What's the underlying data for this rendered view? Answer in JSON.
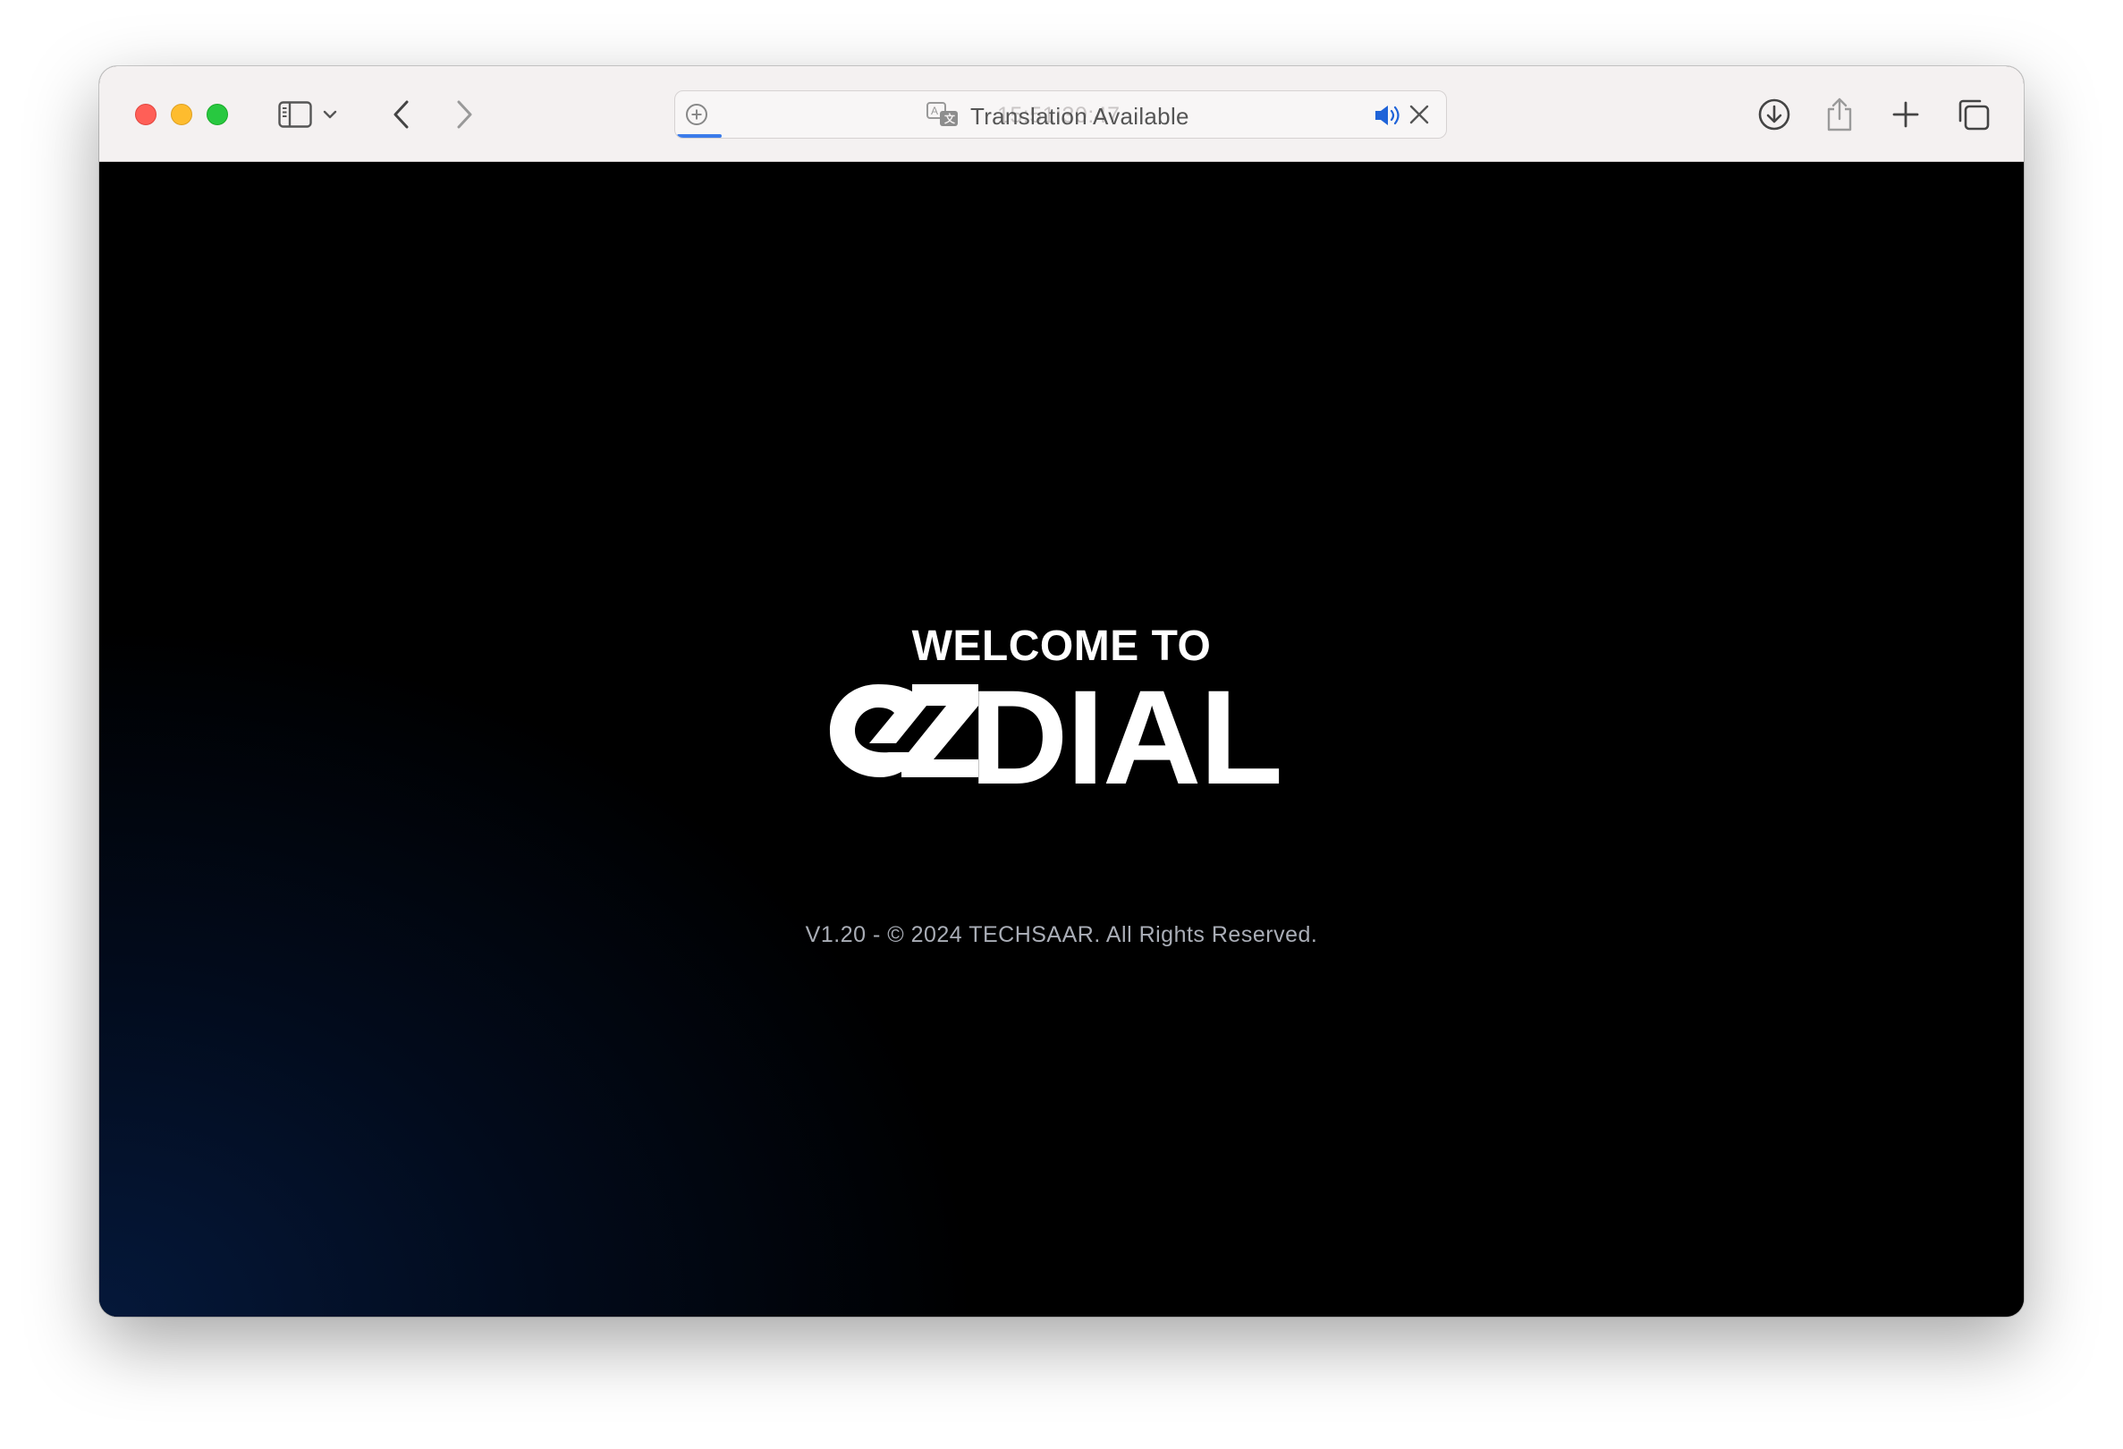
{
  "browser": {
    "address_ghost_text": "15:51:30:47",
    "address_text": "Translation Available",
    "icons": {
      "sidebar": "sidebar-icon",
      "sidebar_menu": "chevron-down-icon",
      "back": "chevron-left-icon",
      "forward": "chevron-right-icon",
      "page_menu": "plus-circle-icon",
      "translate": "translate-icon",
      "audio": "speaker-icon",
      "close": "close-icon",
      "downloads": "download-icon",
      "share": "share-icon",
      "new_tab": "plus-icon",
      "tabs_overview": "tabs-overview-icon"
    },
    "colors": {
      "close": "#ff5f57",
      "minimize": "#febc2e",
      "maximize": "#28c840",
      "accent": "#3b7bea"
    }
  },
  "page": {
    "welcome": "WELCOME TO",
    "logo_text": "DIAL",
    "logo_monogram": "ez",
    "copyright": "V1.20 - © 2024 TECHSAAR. All Rights Reserved.",
    "colors": {
      "background": "#000000",
      "gradient_corner": "#05183a",
      "text": "#ffffff",
      "footer_text": "#a9adb6"
    }
  }
}
